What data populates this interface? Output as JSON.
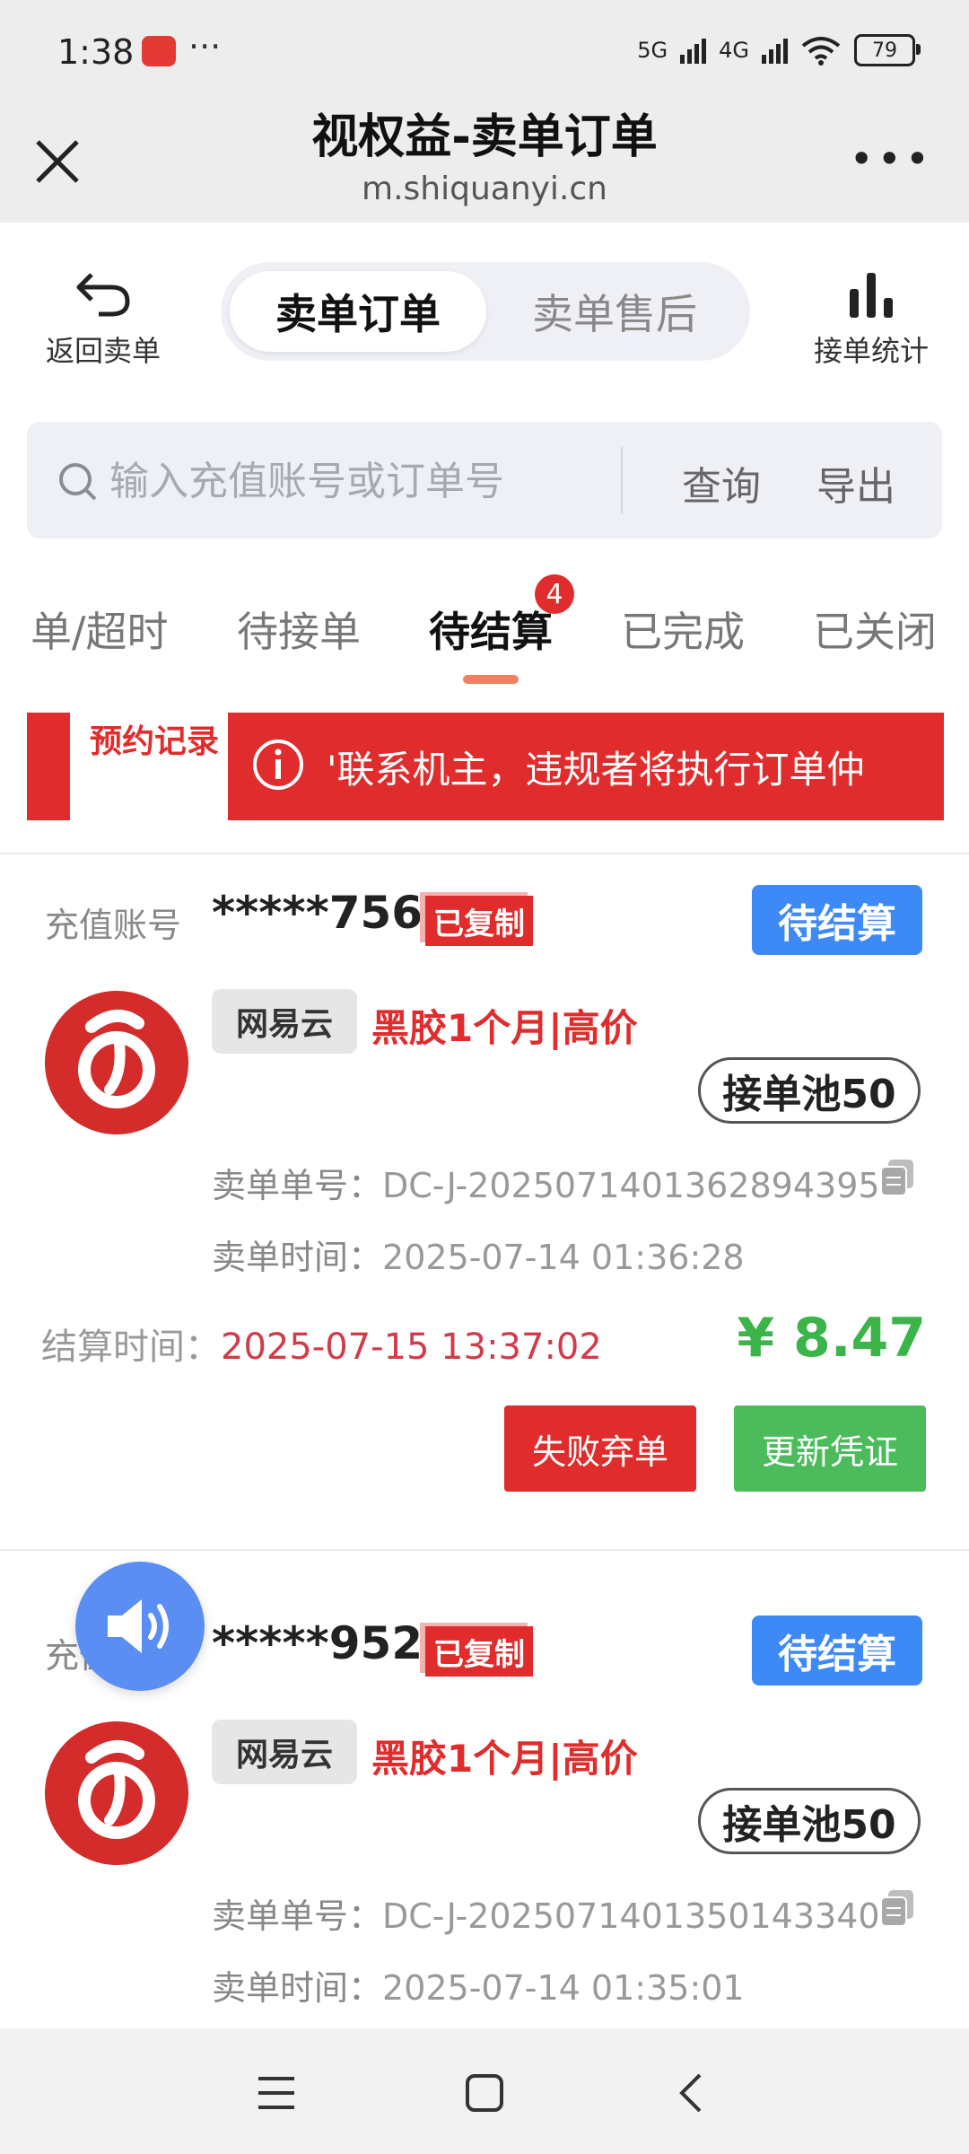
{
  "status_bar": {
    "time": "1:38",
    "signal_5g": "5G",
    "signal_4g": "4G",
    "battery": "79"
  },
  "title_bar": {
    "title": "视权益-卖单订单",
    "url": "m.shiquanyi.cn"
  },
  "header": {
    "back_label": "返回卖单",
    "segments": [
      "卖单订单",
      "卖单售后"
    ],
    "active_segment": 0,
    "stats_label": "接单统计"
  },
  "search": {
    "placeholder": "输入充值账号或订单号",
    "query_label": "查询",
    "export_label": "导出"
  },
  "tabs": [
    {
      "label": "单/超时"
    },
    {
      "label": "待接单"
    },
    {
      "label": "待结算",
      "badge": "4"
    },
    {
      "label": "已完成"
    },
    {
      "label": "已关闭"
    }
  ],
  "notice": {
    "left_label": "预约记录",
    "text": "'联系机主，违规者将执行订单仲"
  },
  "orders": [
    {
      "account_label": "充值账号",
      "account": "*****756",
      "copied_tag": "已复制",
      "status": "待结算",
      "brand": "网易云",
      "product": "黑胶1个月|高价",
      "pool": "接单池50",
      "order_no_label": "卖单单号：",
      "order_no": "DC-J-20250714013628943​95",
      "order_time_label": "卖单时间：",
      "order_time": "2025-07-14 01:36:28",
      "settle_label": "结算时间：",
      "settle_time": "2025-07-15 13:37:02",
      "price": "¥ 8.47",
      "fail_label": "失败弃单",
      "update_label": "更新凭证"
    },
    {
      "account_label": "充值账号",
      "account": "*****952",
      "copied_tag": "已复制",
      "status": "待结算",
      "brand": "网易云",
      "product": "黑胶1个月|高价",
      "pool": "接单池50",
      "order_no_label": "卖单单号：",
      "order_no": "DC-J-20250714013501433​40",
      "order_time_label": "卖单时间：",
      "order_time": "2025-07-14 01:35:01"
    }
  ],
  "colors": {
    "accent_red": "#e02c2c",
    "status_blue": "#3d8af7",
    "price_green": "#3bb54a",
    "settle_red": "#d13b4a"
  }
}
